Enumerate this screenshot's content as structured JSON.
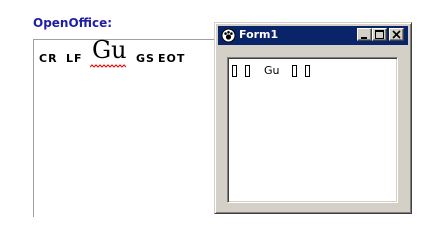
{
  "openoffice": {
    "heading": "OpenOffice:",
    "tokens": {
      "cr": "CR",
      "lf": "LF",
      "gu": "Gu",
      "gs": "GS",
      "eot": "EOT"
    },
    "heading_color": "#1f1fa6",
    "spellcheck_color": "#e00000"
  },
  "form_window": {
    "title": "Form1",
    "title_bar_color": "#0a246a",
    "buttons": [
      "minimize",
      "maximize",
      "close"
    ],
    "textbox": {
      "text": "Gu",
      "unrendered_glyphs_before": 2,
      "unrendered_glyphs_after": 2
    }
  },
  "icons": {
    "app": "app-icon",
    "minimize": "minimize-icon",
    "maximize": "maximize-icon",
    "close": "close-icon"
  }
}
